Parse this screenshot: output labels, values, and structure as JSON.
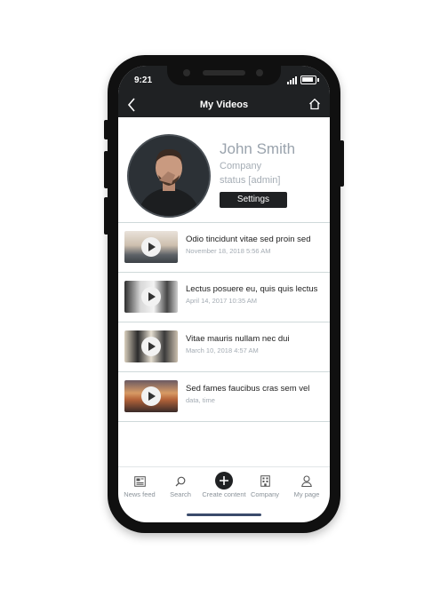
{
  "status_bar": {
    "time": "9:21"
  },
  "header": {
    "title": "My Videos",
    "back_icon": "chevron-left-icon",
    "home_icon": "home-icon"
  },
  "profile": {
    "name": "John Smith",
    "company": "Company",
    "status": "status [admin]",
    "settings_label": "Settings"
  },
  "videos": [
    {
      "title": "Odio tincidunt vitae sed proin sed",
      "date": "November 18, 2018 5:56 AM",
      "thumb_colors": [
        "#d8d4cf",
        "#6b6f73"
      ]
    },
    {
      "title": "Lectus posuere eu, quis quis lectus",
      "date": "April 14, 2017 10:35 AM",
      "thumb_colors": [
        "#e8e8e8",
        "#3a3a3a"
      ]
    },
    {
      "title": "Vitae mauris nullam nec dui",
      "date": "March 10, 2018 4:57 AM",
      "thumb_colors": [
        "#c9c1b4",
        "#2e2e2e"
      ]
    },
    {
      "title": "Sed fames faucibus cras sem vel",
      "date": "data, time",
      "thumb_colors": [
        "#c88a5a",
        "#3a2a28"
      ]
    }
  ],
  "bottom_nav": [
    {
      "label": "News feed",
      "icon": "newspaper-icon"
    },
    {
      "label": "Search",
      "icon": "search-icon"
    },
    {
      "label": "Create content",
      "icon": "plus-circle-icon"
    },
    {
      "label": "Company",
      "icon": "building-icon"
    },
    {
      "label": "My page",
      "icon": "user-icon"
    }
  ]
}
